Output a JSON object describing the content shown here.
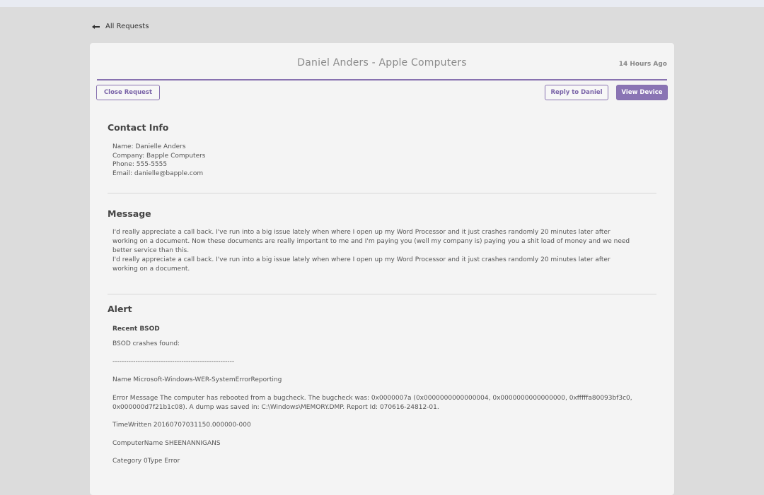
{
  "nav": {
    "back_label": "All Requests"
  },
  "request": {
    "title": "Daniel Anders - Apple Computers",
    "time": "14 Hours Ago"
  },
  "actions": {
    "close_label": "Close Request",
    "reply_label": "Reply to Daniel",
    "view_label": "View Device"
  },
  "contact": {
    "heading": "Contact Info",
    "name_line": "Name: Danielle Anders",
    "company_line": "Company:  Bapple Computers",
    "phone_line": "Phone: 555-5555",
    "email_line": "Email: danielle@bapple.com"
  },
  "message": {
    "heading": "Message",
    "paragraph1": "I'd really appreciate a call back. I've run into a big issue lately when where I open up my Word Processor and it just crashes randomly 20 minutes later after working on a document. Now these documents are really important to me and I'm paying you (well my company is) paying you a shit load of money and we need better service than this.",
    "paragraph2": "I'd really appreciate a call back. I've run into a big issue lately when where I open up my Word Processor and it just crashes randomly 20 minutes later after working on a document."
  },
  "alert": {
    "heading": "Alert",
    "subheading": "Recent BSOD",
    "line_found": "BSOD crashes found:",
    "separator": "-----------------------------------------------------",
    "line_name": "Name Microsoft-Windows-WER-SystemErrorReporting",
    "line_error": "Error Message The computer has rebooted from a bugcheck. The bugcheck was: 0x0000007a (0x0000000000000004, 0x0000000000000000, 0xfffffa80093bf3c0, 0x000000d7f21b1c08). A dump was saved in: C:\\Windows\\MEMORY.DMP. Report Id: 070616-24812-01.",
    "line_time": "TimeWritten 20160707031150.000000-000",
    "line_computer": "ComputerName SHEENANNIGANS",
    "line_category": "Category 0Type Error"
  },
  "colors": {
    "accent": "#8a74b4",
    "page_bg": "#dcdcdc",
    "card_bg": "#f4f4f4"
  }
}
